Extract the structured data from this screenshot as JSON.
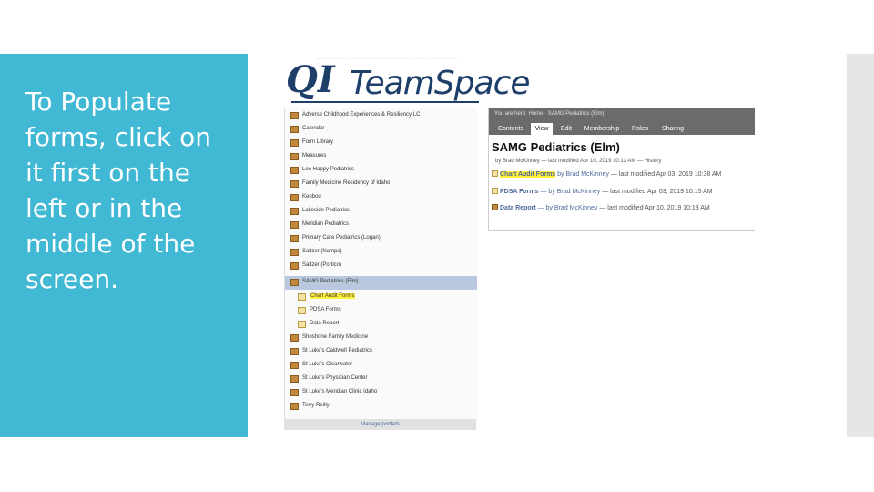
{
  "slide": {
    "text": "To Populate forms, click on it first on the left or in the middle of the screen."
  },
  "logo": {
    "tagline": "——— ——— ——————— ——————— ——— ——————",
    "qi": "QI",
    "teamspace": "TeamSpace"
  },
  "sidebar": {
    "items": [
      {
        "label": "Adverse Childhood Experiences & Resiliency LC"
      },
      {
        "label": "Calendar"
      },
      {
        "label": "Form Library"
      },
      {
        "label": "Measures"
      },
      {
        "label": "Lee Happy Pediatrics"
      },
      {
        "label": "Family Medicine Residency of Idaho"
      },
      {
        "label": "Kenbou"
      },
      {
        "label": "Lakeside Pediatrics"
      },
      {
        "label": "Meridian Pediatrics"
      },
      {
        "label": "Primary Care Pediatrics (Logan)"
      },
      {
        "label": "Saltzer (Nampa)"
      },
      {
        "label": "Saltzer (Portico)"
      },
      {
        "label": "SAMG Pediatrics (Elm)"
      },
      {
        "label": "Chart Audit Forms"
      },
      {
        "label": "PDSA Forms"
      },
      {
        "label": "Data Report"
      },
      {
        "label": "Shoshone Family Medicine"
      },
      {
        "label": "St Luke's Caldwell Pediatrics"
      },
      {
        "label": "St Luke's Clearwater"
      },
      {
        "label": "St Luke's Physician Center"
      },
      {
        "label": "St Luke's Meridian Clinic Idaho"
      },
      {
        "label": "Terry Reilly"
      }
    ],
    "manage": "Manage portlets"
  },
  "content": {
    "breadcrumb": "You are here: Home · SAMG Pediatrics (Elm)",
    "tabs": [
      "Contents",
      "View",
      "Edit",
      "Membership",
      "Roles",
      "Sharing"
    ],
    "title": "SAMG Pediatrics (Elm)",
    "meta": "by Brad McKinney — last modified Apr 10, 2019 10:13 AM — History",
    "rows": [
      {
        "name": "Chart Audit Forms",
        "by": "by Brad McKinney",
        "modified": "— last modified Apr 03, 2019 10:38 AM"
      },
      {
        "name": "PDSA Forms",
        "by": "— by Brad McKinney",
        "modified": "— last modified Apr 03, 2019 10:15 AM"
      },
      {
        "name": "Data Report",
        "by": "— by Brad McKinney",
        "modified": "— last modified Apr 10, 2019 10:13 AM"
      }
    ]
  },
  "colors": {
    "panel": "#41b8d4",
    "highlight": "#fff03a",
    "selected": "#b9c8de",
    "header": "#6b6b6b",
    "link": "#4c6a9b",
    "logo": "#1e3f6a"
  }
}
